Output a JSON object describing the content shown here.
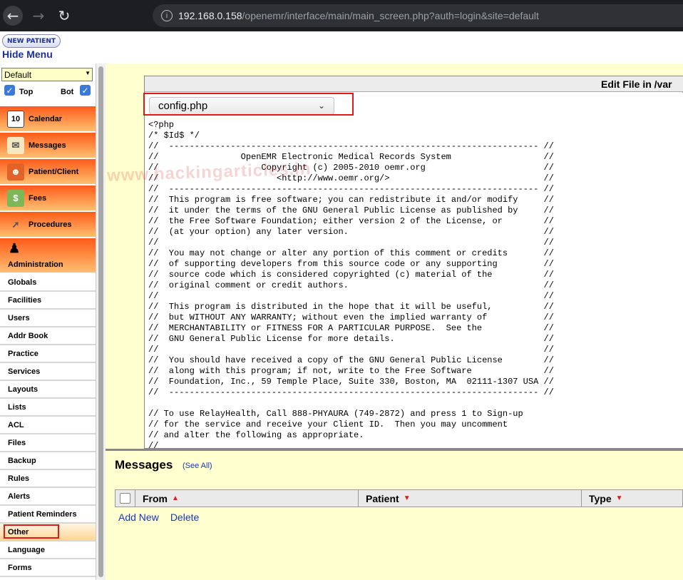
{
  "browser": {
    "url_host": "192.168.0.158",
    "url_path": "/openemr/interface/main/main_screen.php?auth=login&site=default"
  },
  "top": {
    "new_patient": "NEW PATIENT",
    "hide_menu": "Hide Menu"
  },
  "nav": {
    "select_value": "Default",
    "top_label": "Top",
    "bot_label": "Bot",
    "menu": [
      {
        "label": "Calendar",
        "icon": "calendar-icon"
      },
      {
        "label": "Messages",
        "icon": "envelope-icon"
      },
      {
        "label": "Patient/Client",
        "icon": "person-icon"
      },
      {
        "label": "Fees",
        "icon": "money-icon"
      },
      {
        "label": "Procedures",
        "icon": "syringe-icon"
      }
    ],
    "admin_label": "Administration",
    "submenu": [
      "Globals",
      "Facilities",
      "Users",
      "Addr Book",
      "Practice",
      "Services",
      "Layouts",
      "Lists",
      "ACL",
      "Files",
      "Backup",
      "Rules",
      "Alerts",
      "Patient Reminders",
      "Other",
      "Language",
      "Forms"
    ]
  },
  "editor": {
    "title": "Edit File in /var",
    "file_selected": "config.php",
    "code": "<?php\n/* $Id$ */\n//  ------------------------------------------------------------------------ //\n//                OpenEMR Electronic Medical Records System                  //\n//                    Copyright (c) 2005-2010 oemr.org                       //\n//                       <http://www.oemr.org/>                              //\n//  ------------------------------------------------------------------------ //\n//  This program is free software; you can redistribute it and/or modify     //\n//  it under the terms of the GNU General Public License as published by     //\n//  the Free Software Foundation; either version 2 of the License, or        //\n//  (at your option) any later version.                                      //\n//                                                                           //\n//  You may not change or alter any portion of this comment or credits       //\n//  of supporting developers from this source code or any supporting         //\n//  source code which is considered copyrighted (c) material of the          //\n//  original comment or credit authors.                                      //\n//                                                                           //\n//  This program is distributed in the hope that it will be useful,          //\n//  but WITHOUT ANY WARRANTY; without even the implied warranty of           //\n//  MERCHANTABILITY or FITNESS FOR A PARTICULAR PURPOSE.  See the            //\n//  GNU General Public License for more details.                             //\n//                                                                           //\n//  You should have received a copy of the GNU General Public License        //\n//  along with this program; if not, write to the Free Software              //\n//  Foundation, Inc., 59 Temple Place, Suite 330, Boston, MA  02111-1307 USA //\n//  ------------------------------------------------------------------------ //\n\n// To use RelayHealth, Call 888-PHYAURA (749-2872) and press 1 to Sign-up\n// for the service and receive your Client ID.  Then you may uncomment\n// and alter the following as appropriate.\n//"
  },
  "messages": {
    "title": "Messages",
    "see_all": "(See All)",
    "columns": [
      "From",
      "Patient",
      "Type"
    ],
    "add_new": "Add New",
    "delete": "Delete"
  },
  "watermark": "www.hackingarticles.in"
}
